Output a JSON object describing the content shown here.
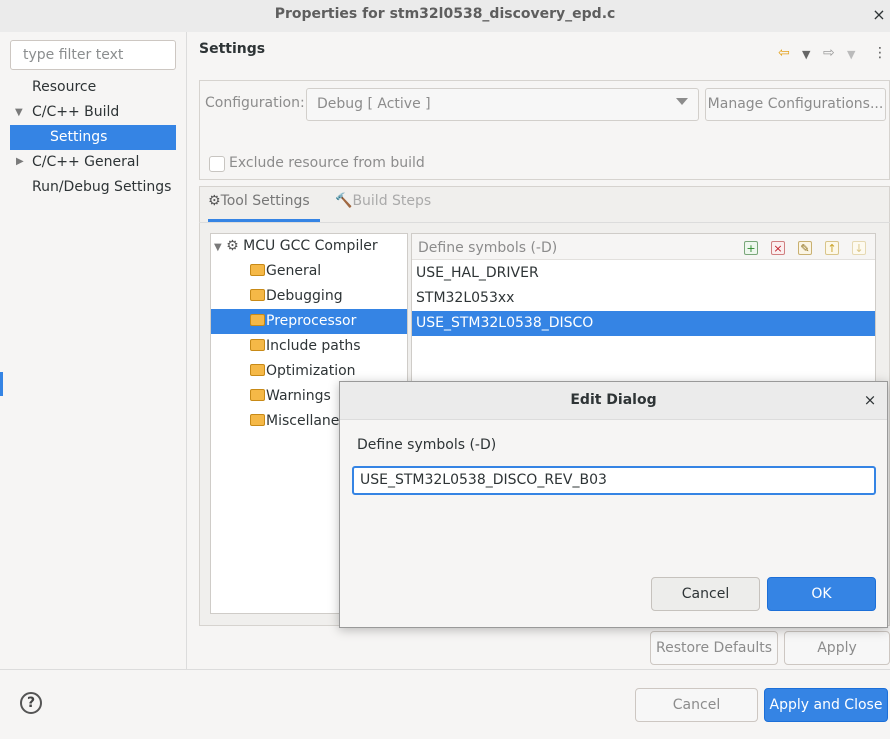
{
  "window": {
    "title": "Properties for stm32l0538_discovery_epd.c",
    "close_icon": "×"
  },
  "filter": {
    "placeholder": "type filter text"
  },
  "nav": {
    "items": [
      {
        "label": "Resource"
      },
      {
        "label": "C/C++ Build",
        "expanded": true
      },
      {
        "label": "Settings",
        "selected": true
      },
      {
        "label": "C/C++ General",
        "expanded": false
      },
      {
        "label": "Run/Debug Settings"
      }
    ]
  },
  "header": {
    "title": "Settings"
  },
  "config": {
    "label": "Configuration:",
    "value": "Debug  [ Active ]",
    "manage_label": "Manage Configurations...",
    "exclude_label": "Exclude resource from build"
  },
  "tabs": [
    {
      "label": "Tool Settings",
      "active": true
    },
    {
      "label": "Build Steps",
      "active": false
    }
  ],
  "tools": {
    "root": "MCU GCC Compiler",
    "items": [
      {
        "label": "General"
      },
      {
        "label": "Debugging"
      },
      {
        "label": "Preprocessor",
        "selected": true
      },
      {
        "label": "Include paths"
      },
      {
        "label": "Optimization"
      },
      {
        "label": "Warnings"
      },
      {
        "label": "Miscellaneous"
      }
    ]
  },
  "symbols": {
    "header": "Define symbols (-D)",
    "items": [
      "USE_HAL_DRIVER",
      "STM32L053xx",
      "USE_STM32L0538_DISCO"
    ],
    "selected_index": 2
  },
  "buttons": {
    "restore_defaults": "Restore Defaults",
    "apply": "Apply",
    "cancel": "Cancel",
    "apply_and_close": "Apply and Close"
  },
  "dialog": {
    "title": "Edit Dialog",
    "close_icon": "×",
    "label": "Define symbols (-D)",
    "input_value": "USE_STM32L0538_DISCO_REV_B03",
    "cancel": "Cancel",
    "ok": "OK"
  },
  "colors": {
    "accent": "#3584e4",
    "folder": "#f5b847"
  }
}
